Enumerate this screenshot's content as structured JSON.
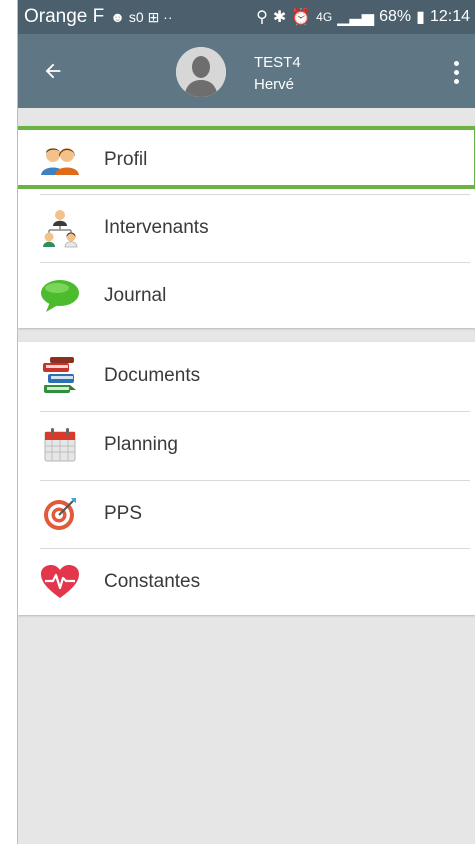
{
  "status_bar": {
    "carrier": "Orange F",
    "indicators_left": "☻ s0 ⊞ ··",
    "battery_percent": "68%",
    "time": "12:14"
  },
  "header": {
    "user_name": "TEST4",
    "user_first_name": "Hervé"
  },
  "menu": {
    "section1": [
      {
        "label": "Profil"
      },
      {
        "label": "Intervenants"
      },
      {
        "label": "Journal"
      }
    ],
    "section2": [
      {
        "label": "Documents"
      },
      {
        "label": "Planning"
      },
      {
        "label": "PPS"
      },
      {
        "label": "Constantes"
      }
    ]
  },
  "colors": {
    "status_bar": "#4b5f6c",
    "app_bar": "#5f7684",
    "highlight": "#6ab445",
    "background": "#e6e6e6"
  },
  "icons": {
    "back": "arrow-left-icon",
    "overflow": "more-vertical-icon",
    "profil": "people-pair-icon",
    "intervenants": "team-hierarchy-icon",
    "journal": "speech-bubble-icon",
    "documents": "books-stack-icon",
    "planning": "calendar-icon",
    "pps": "target-icon",
    "constantes": "heart-pulse-icon"
  }
}
